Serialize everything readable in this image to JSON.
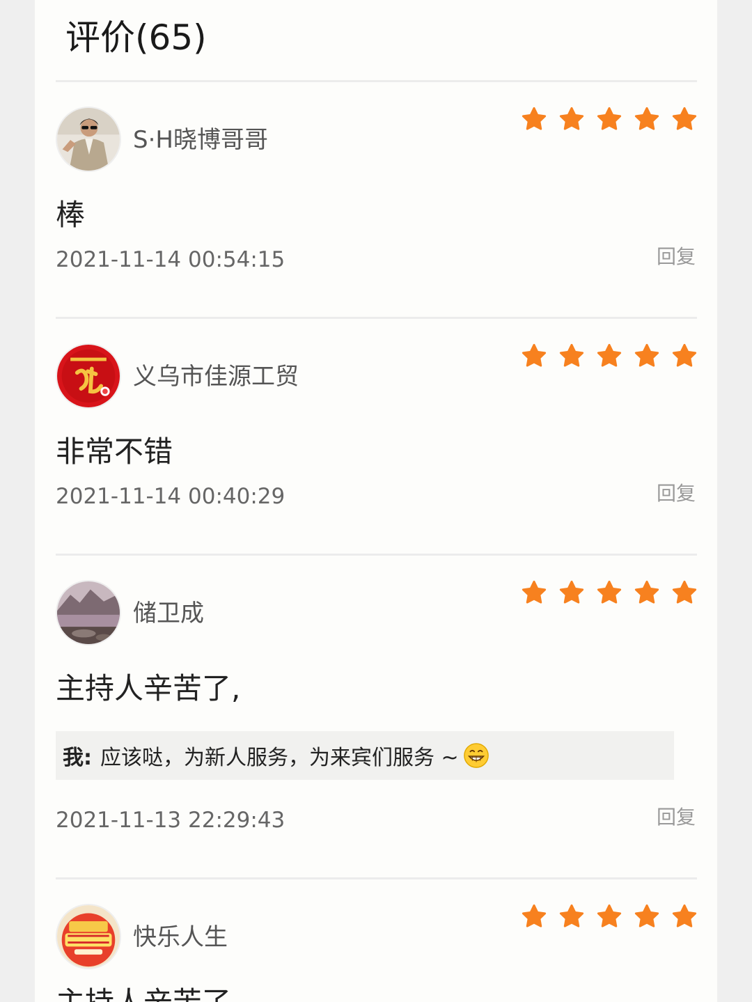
{
  "header": {
    "title": "评价(65)"
  },
  "reviews": [
    {
      "username": "S·H晓博哥哥",
      "rating": 5,
      "comment": "棒",
      "timestamp": "2021-11-14 00:54:15",
      "reply_label": "回复"
    },
    {
      "username": "义乌市佳源工贸",
      "rating": 5,
      "comment": "非常不错",
      "timestamp": "2021-11-14 00:40:29",
      "reply_label": "回复"
    },
    {
      "username": "储卫成",
      "rating": 5,
      "comment": "主持人辛苦了,",
      "owner_reply": {
        "prefix": "我:",
        "text": "应该哒，为新人服务，为来宾们服务 ~",
        "emoji": "grinning-face-icon"
      },
      "timestamp": "2021-11-13 22:29:43",
      "reply_label": "回复"
    },
    {
      "username": "快乐人生",
      "rating": 5,
      "comment": "主持人辛苦了"
    }
  ],
  "colors": {
    "star": "#f7811f",
    "card": "#fdfdfb",
    "reply_bg": "#f1f1ef"
  }
}
